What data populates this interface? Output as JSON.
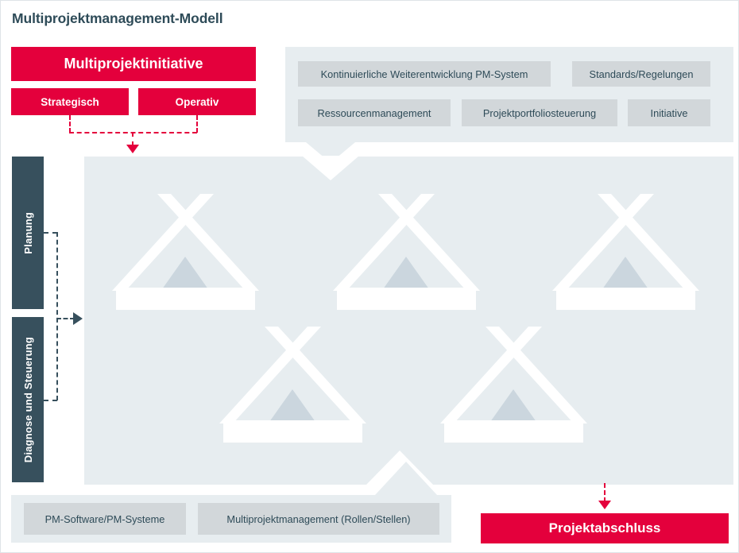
{
  "page": {
    "title": "Multiprojektmanagement-Modell",
    "accent_red": "#e4003c",
    "dark_slate": "#37505d",
    "panel_light": "#e7edf0",
    "chip_gray": "#d2d7da"
  },
  "initiative": {
    "main_label": "Multiprojektinitiative",
    "strategic_label": "Strategisch",
    "operative_label": "Operativ"
  },
  "phases": {
    "planning_label": "Planung",
    "diagnosis_label": "Diagnose und Steuerung"
  },
  "top_panel": {
    "chips": [
      {
        "label": "Kontinuierliche Weiterentwicklung PM-System"
      },
      {
        "label": "Standards/Regelungen"
      },
      {
        "label": "Ressourcenmanagement"
      },
      {
        "label": "Projektportfoliosteuerung"
      },
      {
        "label": "Initiative"
      }
    ]
  },
  "bottom_panel": {
    "chips": [
      {
        "label": "PM-Software/PM-Systeme"
      },
      {
        "label": "Multiprojektmanagement (Rollen/Stellen)"
      }
    ]
  },
  "closure": {
    "label": "Projektabschluss"
  },
  "projects": {
    "icon_name": "tent-icon",
    "count": 5,
    "items": [
      {
        "row": 1,
        "index": 1
      },
      {
        "row": 1,
        "index": 2
      },
      {
        "row": 1,
        "index": 3
      },
      {
        "row": 2,
        "index": 4
      },
      {
        "row": 2,
        "index": 5
      }
    ]
  }
}
